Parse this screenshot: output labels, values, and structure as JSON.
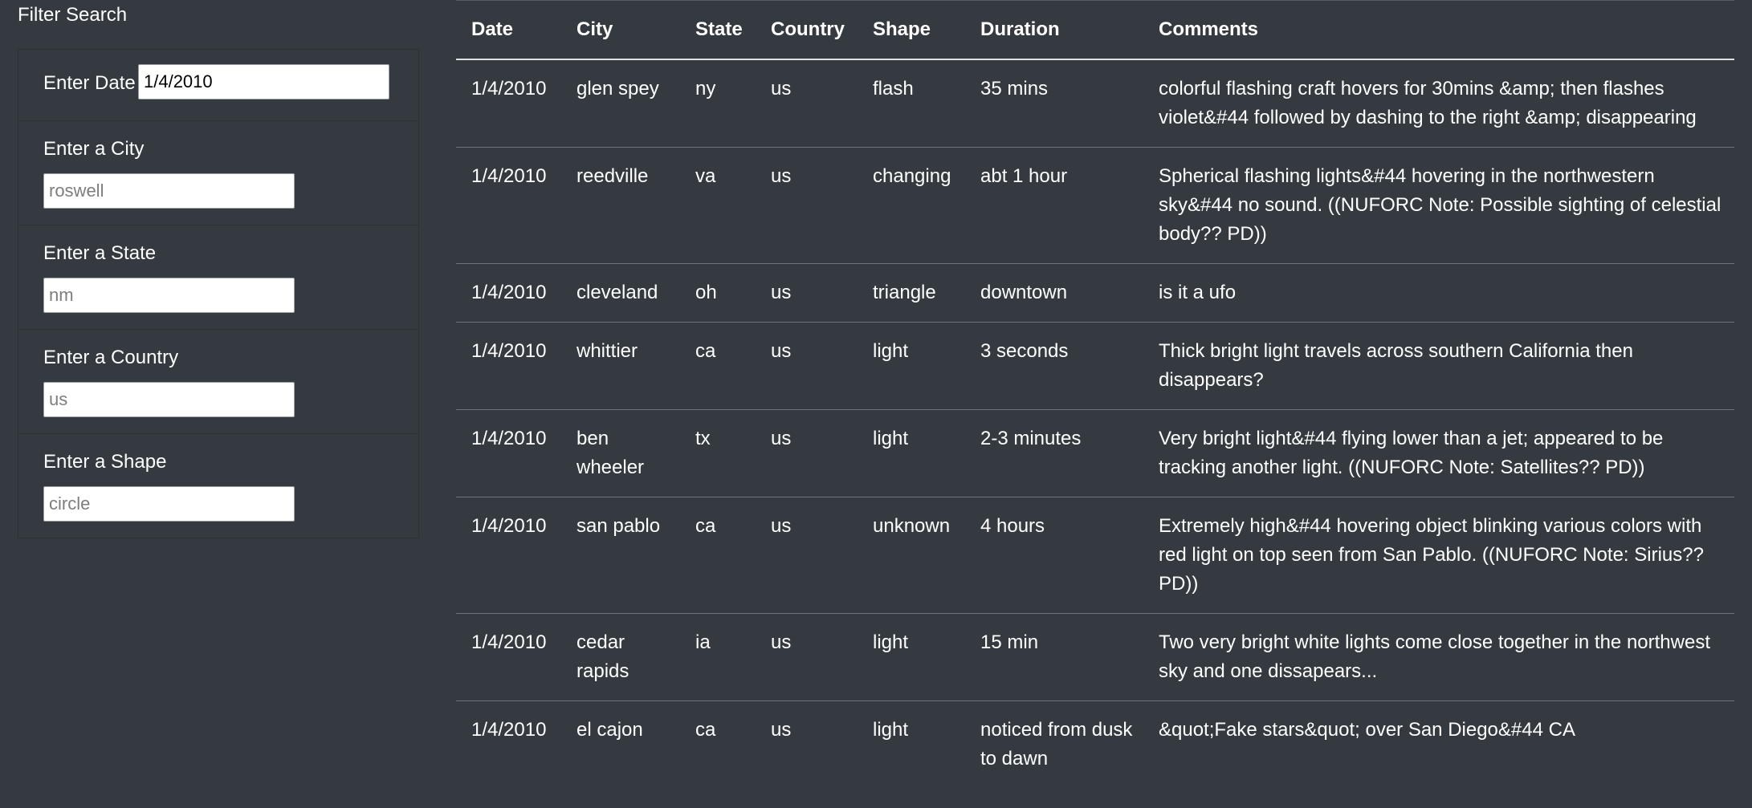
{
  "filter": {
    "title": "Filter Search",
    "date": {
      "label": "Enter Date",
      "value": "1/4/2010",
      "placeholder": ""
    },
    "city": {
      "label": "Enter a City",
      "placeholder": "roswell"
    },
    "state": {
      "label": "Enter a State",
      "placeholder": "nm"
    },
    "country": {
      "label": "Enter a Country",
      "placeholder": "us"
    },
    "shape": {
      "label": "Enter a Shape",
      "placeholder": "circle"
    }
  },
  "table": {
    "headers": [
      "Date",
      "City",
      "State",
      "Country",
      "Shape",
      "Duration",
      "Comments"
    ],
    "rows": [
      [
        "1/4/2010",
        "glen spey",
        "ny",
        "us",
        "flash",
        "35 mins",
        "colorful flashing craft hovers for 30mins &amp; then flashes violet&#44 followed by dashing to the right &amp; disappearing"
      ],
      [
        "1/4/2010",
        "reedville",
        "va",
        "us",
        "changing",
        "abt 1 hour",
        "Spherical flashing lights&#44 hovering in the northwestern sky&#44 no sound. ((NUFORC Note: Possible sighting of celestial body?? PD))"
      ],
      [
        "1/4/2010",
        "cleveland",
        "oh",
        "us",
        "triangle",
        "downtown",
        "is it a ufo"
      ],
      [
        "1/4/2010",
        "whittier",
        "ca",
        "us",
        "light",
        "3 seconds",
        "Thick bright light travels across southern California then disappears?"
      ],
      [
        "1/4/2010",
        "ben wheeler",
        "tx",
        "us",
        "light",
        "2-3 minutes",
        "Very bright light&#44 flying lower than a jet; appeared to be tracking another light. ((NUFORC Note: Satellites?? PD))"
      ],
      [
        "1/4/2010",
        "san pablo",
        "ca",
        "us",
        "unknown",
        "4 hours",
        "Extremely high&#44 hovering object blinking various colors with red light on top seen from San Pablo. ((NUFORC Note: Sirius?? PD))"
      ],
      [
        "1/4/2010",
        "cedar rapids",
        "ia",
        "us",
        "light",
        "15 min",
        "Two very bright white lights come close together in the northwest sky and one dissapears..."
      ],
      [
        "1/4/2010",
        "el cajon",
        "ca",
        "us",
        "light",
        "noticed from dusk to dawn",
        "&quot;Fake stars&quot; over San Diego&#44 CA"
      ]
    ]
  }
}
